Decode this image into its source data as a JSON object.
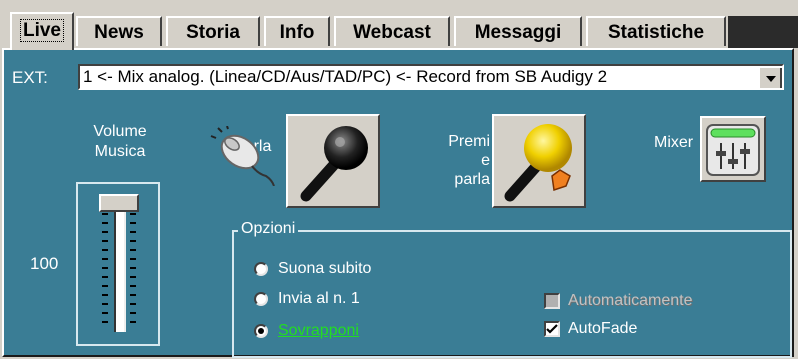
{
  "tabs": [
    {
      "label": "Live",
      "active": true
    },
    {
      "label": "News"
    },
    {
      "label": "Storia"
    },
    {
      "label": "Info"
    },
    {
      "label": "Webcast"
    },
    {
      "label": "Messaggi"
    },
    {
      "label": "Statistiche"
    }
  ],
  "ext": {
    "label": "EXT:",
    "selected": "1 <- Mix analog. (Linea/CD/Aus/TAD/PC) <- Record from SB Audigy 2"
  },
  "volume": {
    "label_line1": "Volume",
    "label_line2": "Musica",
    "value": "100",
    "level": 1.0
  },
  "buttons": {
    "parla_label": "Parla",
    "premi_line1": "Premi",
    "premi_line2": "e",
    "premi_line3": "parla",
    "mixer_label": "Mixer"
  },
  "options": {
    "title": "Opzioni",
    "radios": [
      "Suona subito",
      "Invia al n. 1",
      "Sovrapponi"
    ],
    "selected_radio": "Sovrapponi",
    "automatic_label": "Automaticamente",
    "automatic_checked": false,
    "automatic_enabled": false,
    "autofade_label": "AutoFade",
    "autofade_checked": true
  },
  "colors": {
    "panel": "#3a7d95",
    "selected_option": "#22dd22"
  },
  "icons": [
    "mouse-icon",
    "microphone-icon",
    "yellow-microphone-icon",
    "mixer-icon"
  ]
}
